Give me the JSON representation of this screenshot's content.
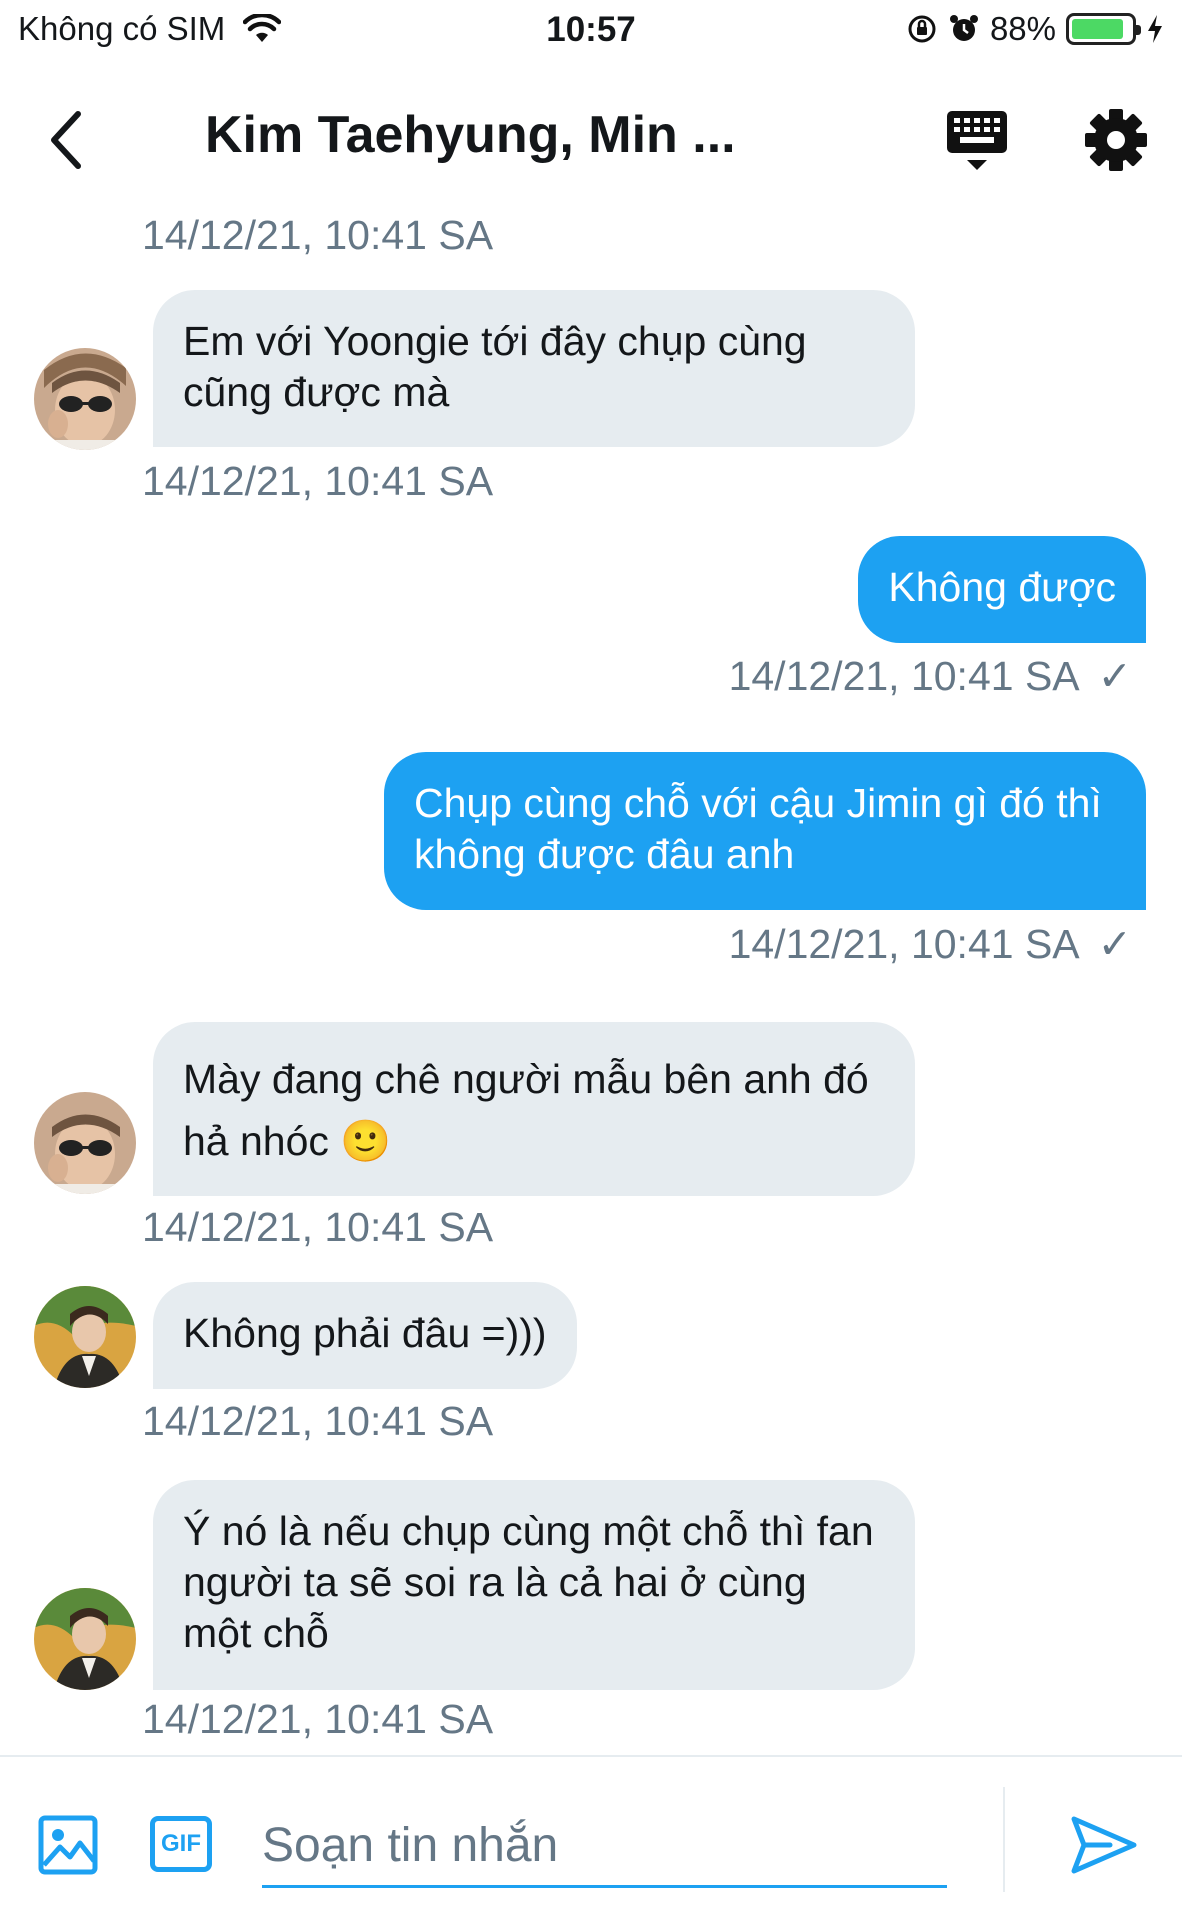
{
  "status_bar": {
    "carrier": "Không có SIM",
    "time": "10:57",
    "battery_percent": "88%",
    "battery_level": 0.88,
    "icons": [
      "wifi-icon",
      "rotation-lock-icon",
      "alarm-icon",
      "battery-icon",
      "charging-icon"
    ]
  },
  "header": {
    "title": "Kim Taehyung, Min ...",
    "icons": [
      "back-chevron-icon",
      "keyboard-icon",
      "gear-icon"
    ]
  },
  "messages": [
    {
      "direction": "in",
      "text": "Em với Yoongie tới đây chụp cùng cũng được mà",
      "timestamp": "14/12/21, 10:41 SA",
      "sender_avatar": "avatar-1"
    },
    {
      "direction": "out",
      "text": "Không được",
      "timestamp": "14/12/21, 10:41 SA",
      "status": "✓"
    },
    {
      "direction": "out",
      "text": "Chụp cùng chỗ với cậu Jimin gì đó thì không được đâu anh",
      "timestamp": "14/12/21, 10:41 SA",
      "status": "✓"
    },
    {
      "direction": "in",
      "text": "Mày đang chê người mẫu bên anh đó hả nhóc 🙂",
      "timestamp": "14/12/21, 10:41 SA",
      "sender_avatar": "avatar-1"
    },
    {
      "direction": "in",
      "text": "Không phải đâu =)))",
      "timestamp": "14/12/21, 10:41 SA",
      "sender_avatar": "avatar-2"
    },
    {
      "direction": "in",
      "text": "Ý nó là nếu chụp cùng một chỗ thì fan người ta sẽ soi ra là cả hai ở cùng một chỗ",
      "timestamp": "14/12/21, 10:41 SA",
      "sender_avatar": "avatar-2"
    }
  ],
  "top_timestamp": "14/12/21, 10:41 SA",
  "composer": {
    "placeholder": "Soạn tin nhắn",
    "gif_label": "GIF",
    "icons": [
      "image-icon",
      "gif-icon",
      "send-icon"
    ]
  },
  "colors": {
    "accent": "#1da1f2",
    "incoming_bubble": "#e6ecf0",
    "timestamp": "#657786",
    "text": "#14171a"
  }
}
